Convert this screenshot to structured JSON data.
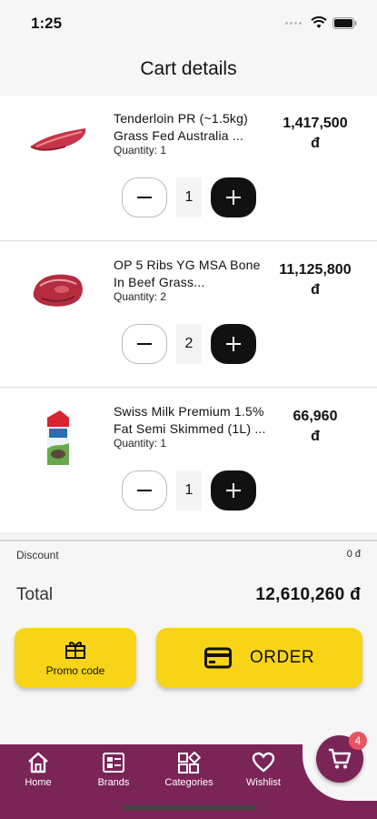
{
  "status": {
    "time": "1:25"
  },
  "header": {
    "title": "Cart details"
  },
  "items": [
    {
      "name": "Tenderloin PR (~1.5kg) Grass Fed Australia ...",
      "quantity_text": "Quantity: 1",
      "price": "1,417,500",
      "currency": "đ",
      "qty": "1",
      "image": "beef-tenderloin"
    },
    {
      "name": "OP 5 Ribs YG MSA Bone In Beef Grass...",
      "quantity_text": "Quantity: 2",
      "price": "11,125,800",
      "currency": "đ",
      "qty": "2",
      "image": "beef-ribs"
    },
    {
      "name": "Swiss Milk Premium 1.5% Fat Semi Skimmed (1L) ...",
      "quantity_text": "Quantity: 1",
      "price": "66,960",
      "currency": "đ",
      "qty": "1",
      "image": "milk-carton"
    }
  ],
  "summary": {
    "discount_label": "Discount",
    "discount_value": "0 đ",
    "total_label": "Total",
    "total_value": "12,610,260 đ"
  },
  "actions": {
    "promo_label": "Promo code",
    "order_label": "ORDER"
  },
  "nav": {
    "items": [
      {
        "label": "Home",
        "icon": "home-icon"
      },
      {
        "label": "Brands",
        "icon": "brands-icon"
      },
      {
        "label": "Categories",
        "icon": "categories-icon"
      },
      {
        "label": "Wishlist",
        "icon": "heart-icon"
      }
    ],
    "cart_count": "4"
  },
  "colors": {
    "accent": "#f7d417",
    "brand": "#7b2458",
    "badge": "#e85561"
  }
}
